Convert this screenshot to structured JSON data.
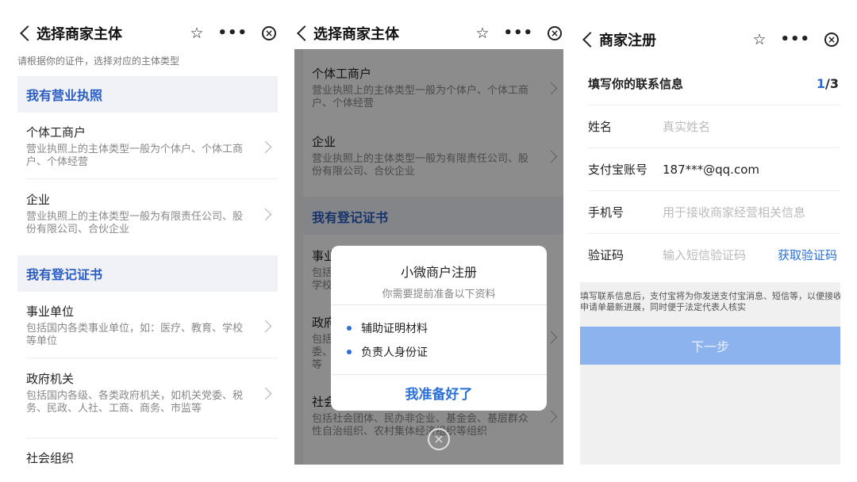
{
  "screen1": {
    "title": "选择商家主体",
    "hint": "请根据你的证件，选择对应的主体类型",
    "section_license": "我有营业执照",
    "section_cert": "我有登记证书",
    "items": [
      {
        "name": "个体工商户",
        "desc": "营业执照上的主体类型一般为个体户、个体工商户、个体经营"
      },
      {
        "name": "企业",
        "desc": "营业执照上的主体类型一般为有限责任公司、股份有限公司、合伙企业"
      },
      {
        "name": "事业单位",
        "desc": "包括国内各类事业单位，如：医疗、教育、学校等单位"
      },
      {
        "name": "政府机关",
        "desc": "包括国内各级、各类政府机关，如机关党委、税务、民政、人社、工商、商务、市监等"
      },
      {
        "name": "社会组织",
        "desc": ""
      }
    ]
  },
  "screen2": {
    "title": "选择商家主体",
    "items": [
      {
        "name": "个体工商户",
        "desc": "营业执照上的主体类型一般为个体户、个体工商户、个体经营"
      },
      {
        "name": "企业",
        "desc": "营业执照上的主体类型一般为有限责任公司、股份有限公司、合伙企业"
      }
    ],
    "section_cert": "我有登记证书",
    "partial_items": [
      {
        "name": "事业",
        "desc": "包括\n学校"
      },
      {
        "name": "政府",
        "desc": "包括\n委、\n等"
      },
      {
        "name": "社会",
        "desc": "包括社会团体、民办非企业、基金会、基层群众性自治组织、农村集体经济组织等组织"
      }
    ],
    "dialog": {
      "title": "小微商户注册",
      "subtitle": "你需要提前准备以下资料",
      "bullets": [
        "辅助证明材料",
        "负责人身份证"
      ],
      "confirm": "我准备好了"
    }
  },
  "screen3": {
    "title": "商家注册",
    "form_head": "填写你的联系信息",
    "step_current": "1",
    "step_total": "/3",
    "fields": [
      {
        "label": "姓名",
        "placeholder": "真实姓名",
        "value": ""
      },
      {
        "label": "支付宝账号",
        "placeholder": "",
        "value": "187***@qq.com"
      },
      {
        "label": "手机号",
        "placeholder": "用于接收商家经营相关信息",
        "value": ""
      },
      {
        "label": "验证码",
        "placeholder": "输入短信验证码",
        "value": ""
      }
    ],
    "get_code": "获取验证码",
    "note_line1": "填写联系信息后，支付宝将为你发送支付宝消息、短信等，以便接收",
    "note_line2": "申请单最新进展，同时便于法定代表人核实",
    "next": "下一步"
  },
  "colors": {
    "accent": "#2a6fd8",
    "section_bg": "#f0f2f7",
    "next_disabled": "#8db3ef"
  }
}
